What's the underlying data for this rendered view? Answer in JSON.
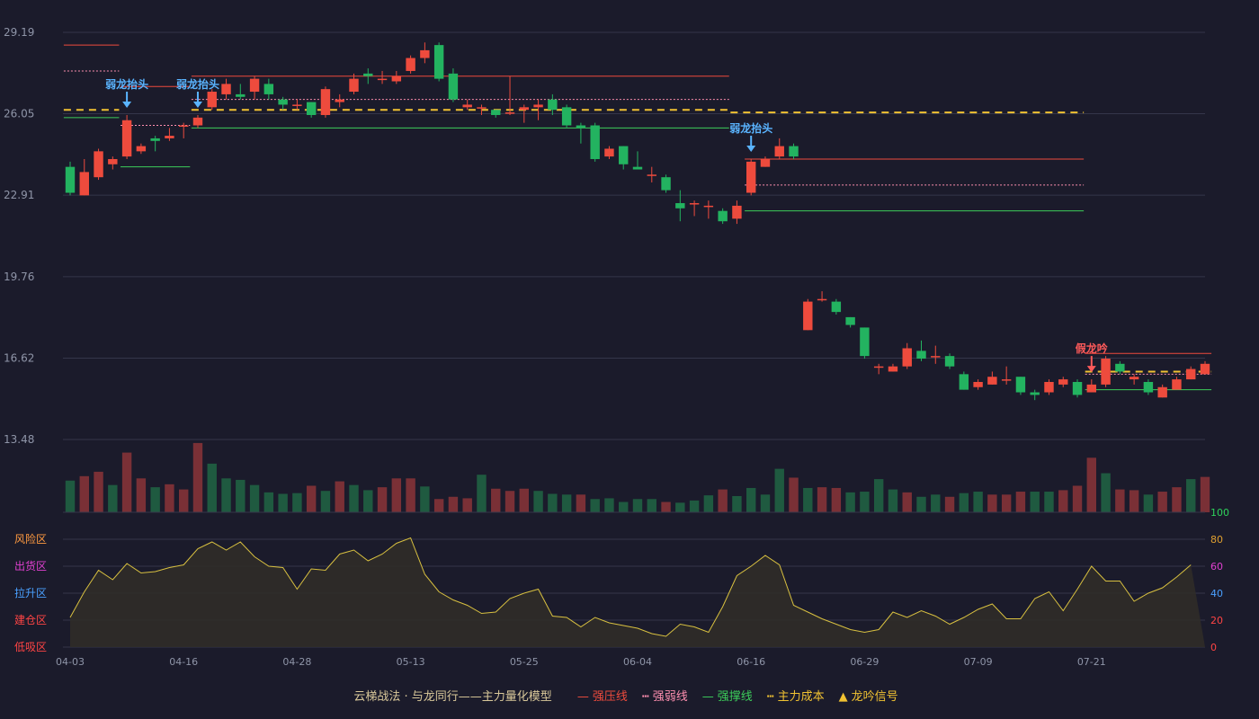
{
  "chart_data": {
    "type": "candlestick",
    "price_ticks": [
      "29.19",
      "26.05",
      "22.91",
      "19.76",
      "16.62",
      "13.48"
    ],
    "price_range": [
      13.48,
      29.19
    ],
    "vol_range": [
      0,
      1
    ],
    "x_labels": [
      "04-03",
      "04-16",
      "04-28",
      "05-13",
      "05-25",
      "06-04",
      "06-16",
      "06-29",
      "07-09",
      "07-21"
    ],
    "x_label_index": [
      0,
      8,
      16,
      24,
      32,
      40,
      48,
      56,
      64,
      72
    ],
    "candles": [
      [
        24.0,
        23.0,
        24.2,
        22.9
      ],
      [
        22.9,
        23.8,
        24.3,
        22.9
      ],
      [
        23.6,
        24.6,
        24.7,
        23.5
      ],
      [
        24.1,
        24.3,
        24.4,
        23.9
      ],
      [
        24.4,
        25.8,
        26.0,
        24.3
      ],
      [
        24.6,
        24.8,
        24.9,
        24.5
      ],
      [
        25.1,
        25.0,
        25.2,
        24.6
      ],
      [
        25.1,
        25.2,
        25.5,
        25.0
      ],
      [
        25.6,
        25.6,
        25.7,
        25.1
      ],
      [
        25.6,
        25.9,
        26.0,
        25.5
      ],
      [
        26.3,
        26.9,
        27.0,
        26.2
      ],
      [
        26.8,
        27.2,
        27.4,
        26.6
      ],
      [
        26.8,
        26.7,
        27.2,
        26.6
      ],
      [
        26.9,
        27.4,
        27.5,
        26.6
      ],
      [
        27.2,
        26.8,
        27.4,
        26.6
      ],
      [
        26.6,
        26.4,
        26.7,
        26.2
      ],
      [
        26.4,
        26.4,
        26.6,
        26.2
      ],
      [
        26.5,
        26.0,
        26.5,
        25.9
      ],
      [
        26.0,
        27.0,
        27.1,
        25.9
      ],
      [
        26.5,
        26.6,
        26.8,
        26.3
      ],
      [
        26.9,
        27.4,
        27.6,
        26.8
      ],
      [
        27.6,
        27.5,
        27.8,
        27.2
      ],
      [
        27.4,
        27.4,
        27.7,
        27.2
      ],
      [
        27.3,
        27.5,
        27.7,
        27.2
      ],
      [
        27.7,
        28.2,
        28.3,
        27.6
      ],
      [
        28.2,
        28.5,
        28.8,
        28.0
      ],
      [
        28.7,
        27.4,
        28.8,
        27.3
      ],
      [
        27.6,
        26.6,
        27.8,
        26.5
      ],
      [
        26.3,
        26.4,
        26.6,
        26.2
      ],
      [
        26.3,
        26.3,
        26.4,
        26.0
      ],
      [
        26.2,
        26.0,
        26.2,
        25.9
      ],
      [
        26.1,
        26.1,
        27.5,
        26.0
      ],
      [
        26.2,
        26.3,
        26.4,
        25.7
      ],
      [
        26.3,
        26.4,
        26.6,
        25.8
      ],
      [
        26.6,
        26.2,
        26.8,
        26.0
      ],
      [
        26.3,
        25.6,
        26.4,
        25.5
      ],
      [
        25.6,
        25.5,
        25.7,
        24.9
      ],
      [
        25.6,
        24.3,
        25.7,
        24.2
      ],
      [
        24.4,
        24.7,
        24.8,
        24.3
      ],
      [
        24.8,
        24.1,
        24.8,
        23.9
      ],
      [
        24.0,
        23.9,
        24.6,
        23.9
      ],
      [
        23.7,
        23.7,
        24.0,
        23.4
      ],
      [
        23.6,
        23.1,
        23.7,
        23.0
      ],
      [
        22.6,
        22.4,
        23.1,
        21.9
      ],
      [
        22.6,
        22.6,
        22.7,
        22.1
      ],
      [
        22.5,
        22.5,
        22.7,
        22.0
      ],
      [
        22.3,
        21.9,
        22.4,
        21.8
      ],
      [
        22.0,
        22.5,
        22.7,
        21.8
      ],
      [
        23.0,
        24.2,
        24.3,
        22.9
      ],
      [
        24.0,
        24.3,
        24.4,
        24.0
      ],
      [
        24.4,
        24.8,
        25.1,
        24.3
      ],
      [
        24.8,
        24.4,
        24.9,
        24.3
      ],
      [
        17.7,
        18.8,
        18.9,
        17.7
      ],
      [
        18.9,
        18.9,
        19.2,
        18.8
      ],
      [
        18.8,
        18.4,
        18.9,
        18.3
      ],
      [
        18.2,
        17.9,
        18.2,
        17.8
      ],
      [
        17.8,
        16.7,
        17.8,
        16.6
      ],
      [
        16.3,
        16.3,
        16.4,
        16.0
      ],
      [
        16.1,
        16.3,
        16.4,
        16.1
      ],
      [
        16.3,
        17.0,
        17.2,
        16.2
      ],
      [
        16.9,
        16.6,
        17.3,
        16.5
      ],
      [
        16.7,
        16.7,
        17.1,
        16.4
      ],
      [
        16.7,
        16.3,
        16.8,
        16.2
      ],
      [
        16.0,
        15.4,
        16.1,
        15.4
      ],
      [
        15.5,
        15.7,
        15.8,
        15.4
      ],
      [
        15.6,
        15.9,
        16.1,
        15.6
      ],
      [
        15.8,
        15.8,
        16.3,
        15.6
      ],
      [
        15.9,
        15.3,
        15.9,
        15.2
      ],
      [
        15.3,
        15.2,
        15.4,
        15.0
      ],
      [
        15.3,
        15.7,
        15.8,
        15.2
      ],
      [
        15.6,
        15.8,
        15.9,
        15.5
      ],
      [
        15.7,
        15.2,
        15.8,
        15.1
      ],
      [
        15.3,
        15.6,
        15.8,
        15.3
      ],
      [
        15.6,
        16.6,
        16.7,
        15.5
      ],
      [
        16.4,
        16.1,
        16.5,
        16.0
      ],
      [
        15.8,
        15.9,
        16.0,
        15.6
      ],
      [
        15.7,
        15.3,
        15.8,
        15.2
      ],
      [
        15.1,
        15.5,
        15.6,
        15.1
      ],
      [
        15.4,
        15.8,
        15.9,
        15.4
      ],
      [
        15.8,
        16.2,
        16.3,
        15.8
      ],
      [
        16.0,
        16.4,
        16.5,
        16.0
      ]
    ],
    "volumes": [
      0.43,
      0.49,
      0.55,
      0.37,
      0.81,
      0.46,
      0.34,
      0.38,
      0.31,
      0.94,
      0.66,
      0.46,
      0.44,
      0.37,
      0.27,
      0.25,
      0.26,
      0.36,
      0.29,
      0.42,
      0.37,
      0.3,
      0.34,
      0.46,
      0.46,
      0.35,
      0.18,
      0.21,
      0.19,
      0.51,
      0.32,
      0.29,
      0.32,
      0.29,
      0.25,
      0.24,
      0.24,
      0.18,
      0.19,
      0.14,
      0.18,
      0.18,
      0.14,
      0.13,
      0.16,
      0.23,
      0.31,
      0.22,
      0.33,
      0.24,
      0.59,
      0.47,
      0.33,
      0.34,
      0.33,
      0.27,
      0.28,
      0.45,
      0.31,
      0.27,
      0.21,
      0.24,
      0.21,
      0.26,
      0.28,
      0.24,
      0.24,
      0.28,
      0.28,
      0.28,
      0.3,
      0.36,
      0.74,
      0.53,
      0.31,
      0.3,
      0.24,
      0.28,
      0.34,
      0.45,
      0.48
    ],
    "vol_up": [
      false,
      true,
      true,
      false,
      true,
      true,
      false,
      true,
      true,
      true,
      false,
      false,
      false,
      false,
      false,
      false,
      false,
      true,
      false,
      true,
      false,
      false,
      true,
      true,
      true,
      false,
      true,
      true,
      true,
      false,
      true,
      true,
      true,
      false,
      false,
      false,
      true,
      false,
      false,
      false,
      false,
      false,
      true,
      false,
      false,
      false,
      true,
      false,
      false,
      false,
      false,
      true,
      false,
      true,
      true,
      false,
      false,
      false,
      false,
      true,
      false,
      false,
      true,
      false,
      false,
      true,
      true,
      true,
      false,
      false,
      true,
      true,
      true,
      false,
      true,
      true,
      false,
      true,
      true,
      false,
      true
    ],
    "indicator": {
      "yticks": [
        "100",
        "80",
        "60",
        "40",
        "20",
        "0"
      ],
      "ytick_colors": [
        "#2ed15a",
        "#e0a030",
        "#e040d0",
        "#4aa0ff",
        "#ff4444",
        "#ff4444"
      ],
      "zones": [
        "风险区",
        "出货区",
        "拉升区",
        "建仓区",
        "低吸区"
      ],
      "zone_colors": [
        "#ff9a40",
        "#e040d0",
        "#4aa0ff",
        "#ff4444",
        "#ff4444"
      ],
      "values": [
        22,
        41,
        57,
        50,
        62,
        55,
        56,
        59,
        61,
        73,
        78,
        72,
        78,
        67,
        60,
        59,
        43,
        58,
        57,
        69,
        72,
        64,
        69,
        77,
        81,
        54,
        41,
        35,
        31,
        25,
        26,
        36,
        40,
        43,
        23,
        22,
        15,
        22,
        18,
        16,
        14,
        10,
        8,
        17,
        15,
        11,
        30,
        53,
        60,
        68,
        61,
        31,
        26,
        21,
        17,
        13,
        11,
        13,
        26,
        22,
        27,
        23,
        17,
        22,
        28,
        32,
        21,
        21,
        36,
        41,
        27,
        43,
        60,
        49,
        49,
        34,
        40,
        44,
        52,
        61
      ]
    },
    "signals": [
      {
        "index": 4,
        "text": "弱龙抬头",
        "type": "up"
      },
      {
        "index": 9,
        "text": "弱龙抬头",
        "type": "up"
      },
      {
        "index": 48,
        "text": "弱龙抬头",
        "type": "up"
      },
      {
        "index": 72,
        "text": "假龙吟",
        "type": "down"
      }
    ],
    "levels": [
      {
        "kind": "pressure",
        "i0": 0,
        "i1": 3,
        "v": 28.7
      },
      {
        "kind": "weak",
        "i0": 0,
        "i1": 3,
        "v": 27.7
      },
      {
        "kind": "cost",
        "i0": 0,
        "i1": 3,
        "v": 26.2
      },
      {
        "kind": "support",
        "i0": 0,
        "i1": 3,
        "v": 25.9
      },
      {
        "kind": "pressure",
        "i0": 4,
        "i1": 8,
        "v": 27.1
      },
      {
        "kind": "weak",
        "i0": 4,
        "i1": 8,
        "v": 25.6
      },
      {
        "kind": "support",
        "i0": 4,
        "i1": 8,
        "v": 24.0
      },
      {
        "kind": "pressure",
        "i0": 9,
        "i1": 46,
        "v": 27.5
      },
      {
        "kind": "weak",
        "i0": 9,
        "i1": 46,
        "v": 26.6
      },
      {
        "kind": "cost",
        "i0": 9,
        "i1": 46,
        "v": 26.2
      },
      {
        "kind": "support",
        "i0": 9,
        "i1": 46,
        "v": 25.5
      },
      {
        "kind": "cost",
        "i0": 47,
        "i1": 71,
        "v": 26.1
      },
      {
        "kind": "pressure",
        "i0": 48,
        "i1": 71,
        "v": 24.3
      },
      {
        "kind": "weak",
        "i0": 48,
        "i1": 71,
        "v": 23.3
      },
      {
        "kind": "support",
        "i0": 48,
        "i1": 71,
        "v": 22.3
      },
      {
        "kind": "pressure",
        "i0": 72,
        "i1": 80,
        "v": 16.8
      },
      {
        "kind": "weak",
        "i0": 72,
        "i1": 80,
        "v": 16.0
      },
      {
        "kind": "cost",
        "i0": 72,
        "i1": 80,
        "v": 16.1
      },
      {
        "kind": "support",
        "i0": 72,
        "i1": 80,
        "v": 15.4
      }
    ],
    "colors": {
      "up": "#ee4b3d",
      "down": "#23b360",
      "grid": "#34364a",
      "axis": "#8f95a8",
      "pressure": "#ee4b3d",
      "weak": "#ff8fb0",
      "support": "#3ccd5a",
      "cost": "#f1c232",
      "volUp": "#7a3036",
      "volDown": "#1f5a40",
      "indLine": "#d8c040",
      "indFill": "#302c28",
      "signalUp": "#5ab4ff",
      "signalDown": "#ff5a5a"
    }
  },
  "legend": {
    "title": "云梯战法 · 与龙同行——主力量化模型",
    "items": [
      {
        "label": "强压线",
        "color": "#ee4b3d",
        "style": "solid"
      },
      {
        "label": "强弱线",
        "color": "#ff8fb0",
        "style": "dotted"
      },
      {
        "label": "强撑线",
        "color": "#3ccd5a",
        "style": "solid"
      },
      {
        "label": "主力成本",
        "color": "#f1c232",
        "style": "dashed"
      },
      {
        "label": "龙吟信号",
        "color": "#f1c232",
        "style": "triangle"
      }
    ]
  }
}
